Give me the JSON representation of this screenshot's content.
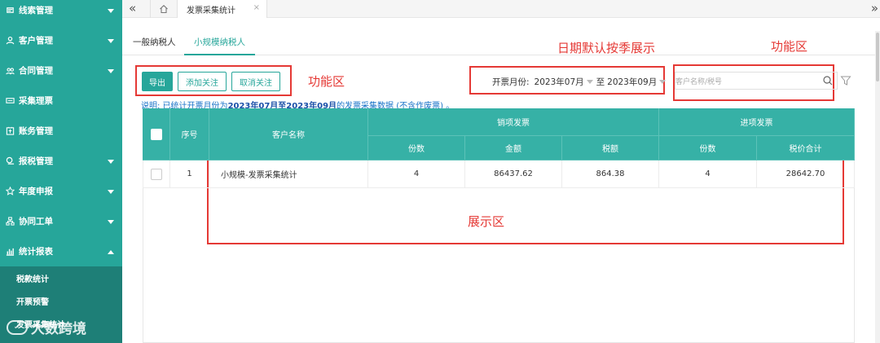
{
  "sidebar": {
    "items": [
      {
        "label": "线索管理",
        "icon": "lead-icon"
      },
      {
        "label": "客户管理",
        "icon": "user-icon"
      },
      {
        "label": "合同管理",
        "icon": "contract-icon"
      },
      {
        "label": "采集理票",
        "icon": "ticket-icon"
      },
      {
        "label": "账务管理",
        "icon": "account-icon"
      },
      {
        "label": "报税管理",
        "icon": "tax-icon"
      },
      {
        "label": "年度申报",
        "icon": "calendar-icon"
      },
      {
        "label": "协同工单",
        "icon": "workflow-icon"
      },
      {
        "label": "统计报表",
        "icon": "chart-icon"
      }
    ],
    "submenu": [
      "税款统计",
      "开票预警",
      "发票采集统计"
    ],
    "watermark": "大数跨境"
  },
  "tabbar": {
    "collapse_icon": "«",
    "home_icon": "home-icon",
    "active_tab": "发票采集统计",
    "close": "×",
    "more": "»"
  },
  "subtabs": [
    "一般纳税人",
    "小规模纳税人"
  ],
  "annotations": {
    "function_area_left": "功能区",
    "date_default": "日期默认按季展示",
    "function_area_right": "功能区",
    "display_area": "展示区"
  },
  "toolbar": {
    "export": "导出",
    "add_follow": "添加关注",
    "cancel_follow": "取消关注"
  },
  "filter": {
    "label": "开票月份:",
    "from": "2023年07月",
    "to_sep": "至",
    "to": "2023年09月",
    "search_placeholder": "客户名称/税号"
  },
  "note": {
    "prefix": "说明: 已统计开票月份为",
    "range": "2023年07月至2023年09月",
    "suffix": "的发票采集数据 (不含作废票) 。"
  },
  "table": {
    "headers": {
      "seq": "序号",
      "customer": "客户名称",
      "sales_group": "销项发票",
      "input_group": "进项发票",
      "sales_count": "份数",
      "sales_amount": "金额",
      "sales_tax": "税额",
      "input_count": "份数",
      "input_total": "税价合计"
    },
    "rows": [
      {
        "seq": "1",
        "customer": "小规模-发票采集统计",
        "sales_count": "4",
        "sales_amount": "86437.62",
        "sales_tax": "864.38",
        "input_count": "4",
        "input_total": "28642.70"
      }
    ]
  },
  "colors": {
    "accent": "#26a69a",
    "header": "#36b1a6",
    "annotation": "#e53935"
  }
}
